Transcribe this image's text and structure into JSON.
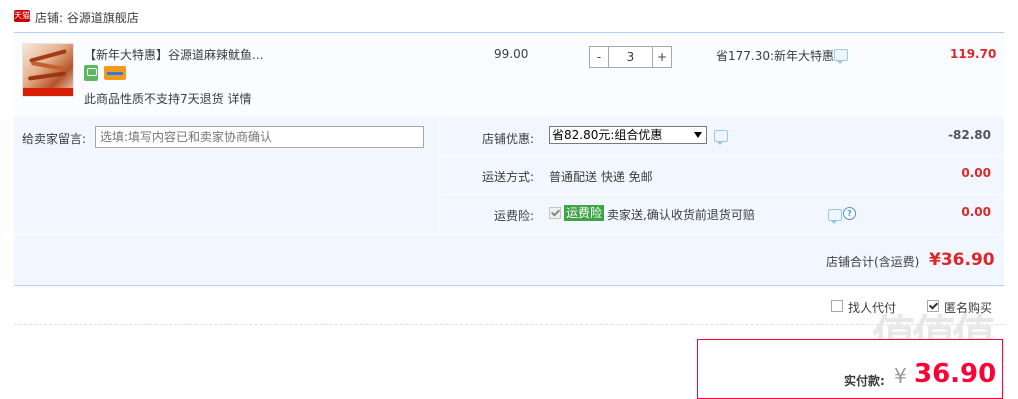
{
  "shop": {
    "badge": "天猫",
    "label": "店铺: 谷源道旗舰店"
  },
  "item": {
    "title": "【新年大特惠】谷源道麻辣鱿鱼...",
    "image_icon": "squid-snack-product-image",
    "service_icons": [
      "green-guarantee-icon",
      "credit-card-icon"
    ],
    "return_note": "此商品性质不支持7天退货",
    "return_detail": "详情",
    "price": "99.00",
    "quantity": "3",
    "qty_minus": "-",
    "qty_plus": "+",
    "promotion": "省177.30:新年大特惠",
    "total": "119.70"
  },
  "message": {
    "label": "给卖家留言:",
    "placeholder": "选填:填写内容已和卖家协商确认"
  },
  "shop_discount": {
    "label": "店铺优惠:",
    "selected": "省82.80元:组合优惠",
    "amount": "-82.80"
  },
  "shipping": {
    "label": "运送方式:",
    "value": "普通配送 快递 免邮",
    "amount": "0.00"
  },
  "insurance": {
    "label": "运费险:",
    "badge": "运费险",
    "text": "卖家送,确认收货前退货可赔",
    "amount": "0.00"
  },
  "shop_total": {
    "label": "店铺合计(含运费)",
    "value": "¥36.90"
  },
  "options": {
    "proxy_pay": {
      "label": "找人代付",
      "checked": false
    },
    "anonymous": {
      "label": "匿名购买",
      "checked": true
    }
  },
  "payment": {
    "label": "实付款:",
    "currency": "¥",
    "value": "36.90"
  },
  "watermark": "值值值",
  "colors": {
    "accent_red": "#dd2727",
    "pay_red": "#ff0036",
    "service_bg": "#f2f7ff",
    "divider_blue": "#b2d1ff"
  }
}
